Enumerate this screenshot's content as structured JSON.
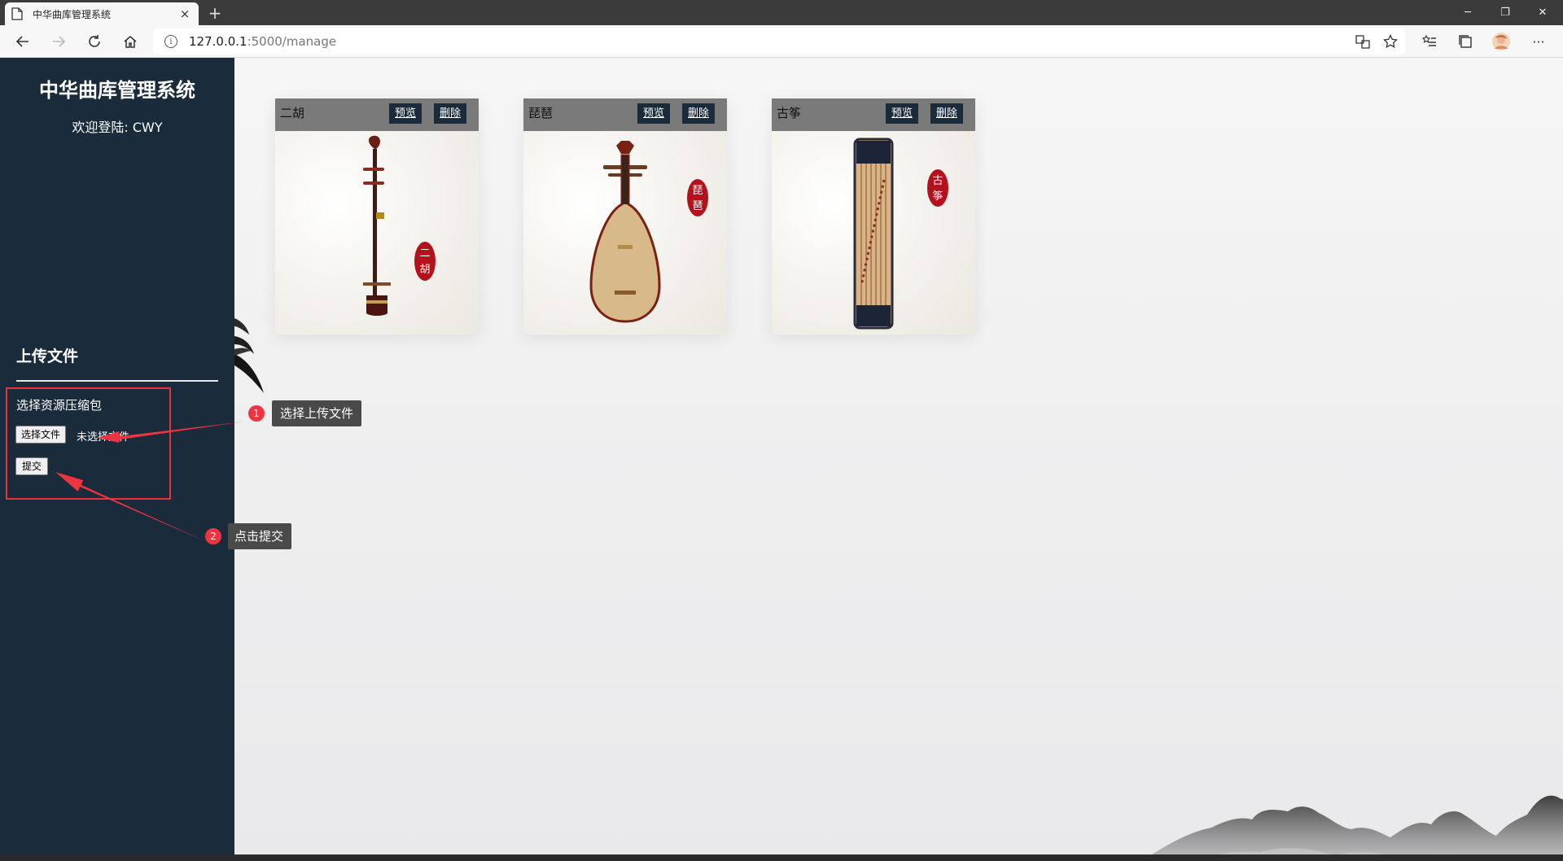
{
  "browser": {
    "tab_title": "中华曲库管理系统",
    "tab_close": "×",
    "new_tab": "+",
    "url_host": "127.0.0.1",
    "url_path": ":5000/manage",
    "win_minimize": "─",
    "win_restore": "❐",
    "win_close": "✕",
    "more": "···"
  },
  "sidebar": {
    "title": "中华曲库管理系统",
    "welcome": "欢迎登陆: CWY",
    "upload_heading": "上传文件",
    "upload_label": "选择资源压缩包",
    "choose_file_button": "选择文件",
    "file_status": "未选择文件",
    "submit_button": "提交"
  },
  "cards": [
    {
      "name": "二胡",
      "preview": "预览",
      "delete": "删除",
      "seal": [
        "二",
        "胡"
      ]
    },
    {
      "name": "琵琶",
      "preview": "预览",
      "delete": "删除",
      "seal": [
        "琵",
        "琶"
      ]
    },
    {
      "name": "古筝",
      "preview": "预览",
      "delete": "删除",
      "seal": [
        "古",
        "筝"
      ]
    }
  ],
  "annotations": [
    {
      "number": "1",
      "text": "选择上传文件"
    },
    {
      "number": "2",
      "text": "点击提交"
    }
  ],
  "colors": {
    "sidebar_bg": "#1a2b3c",
    "card_header": "#7a7a7a",
    "annotation_red": "#e8323a",
    "seal_red": "#b3121c"
  }
}
